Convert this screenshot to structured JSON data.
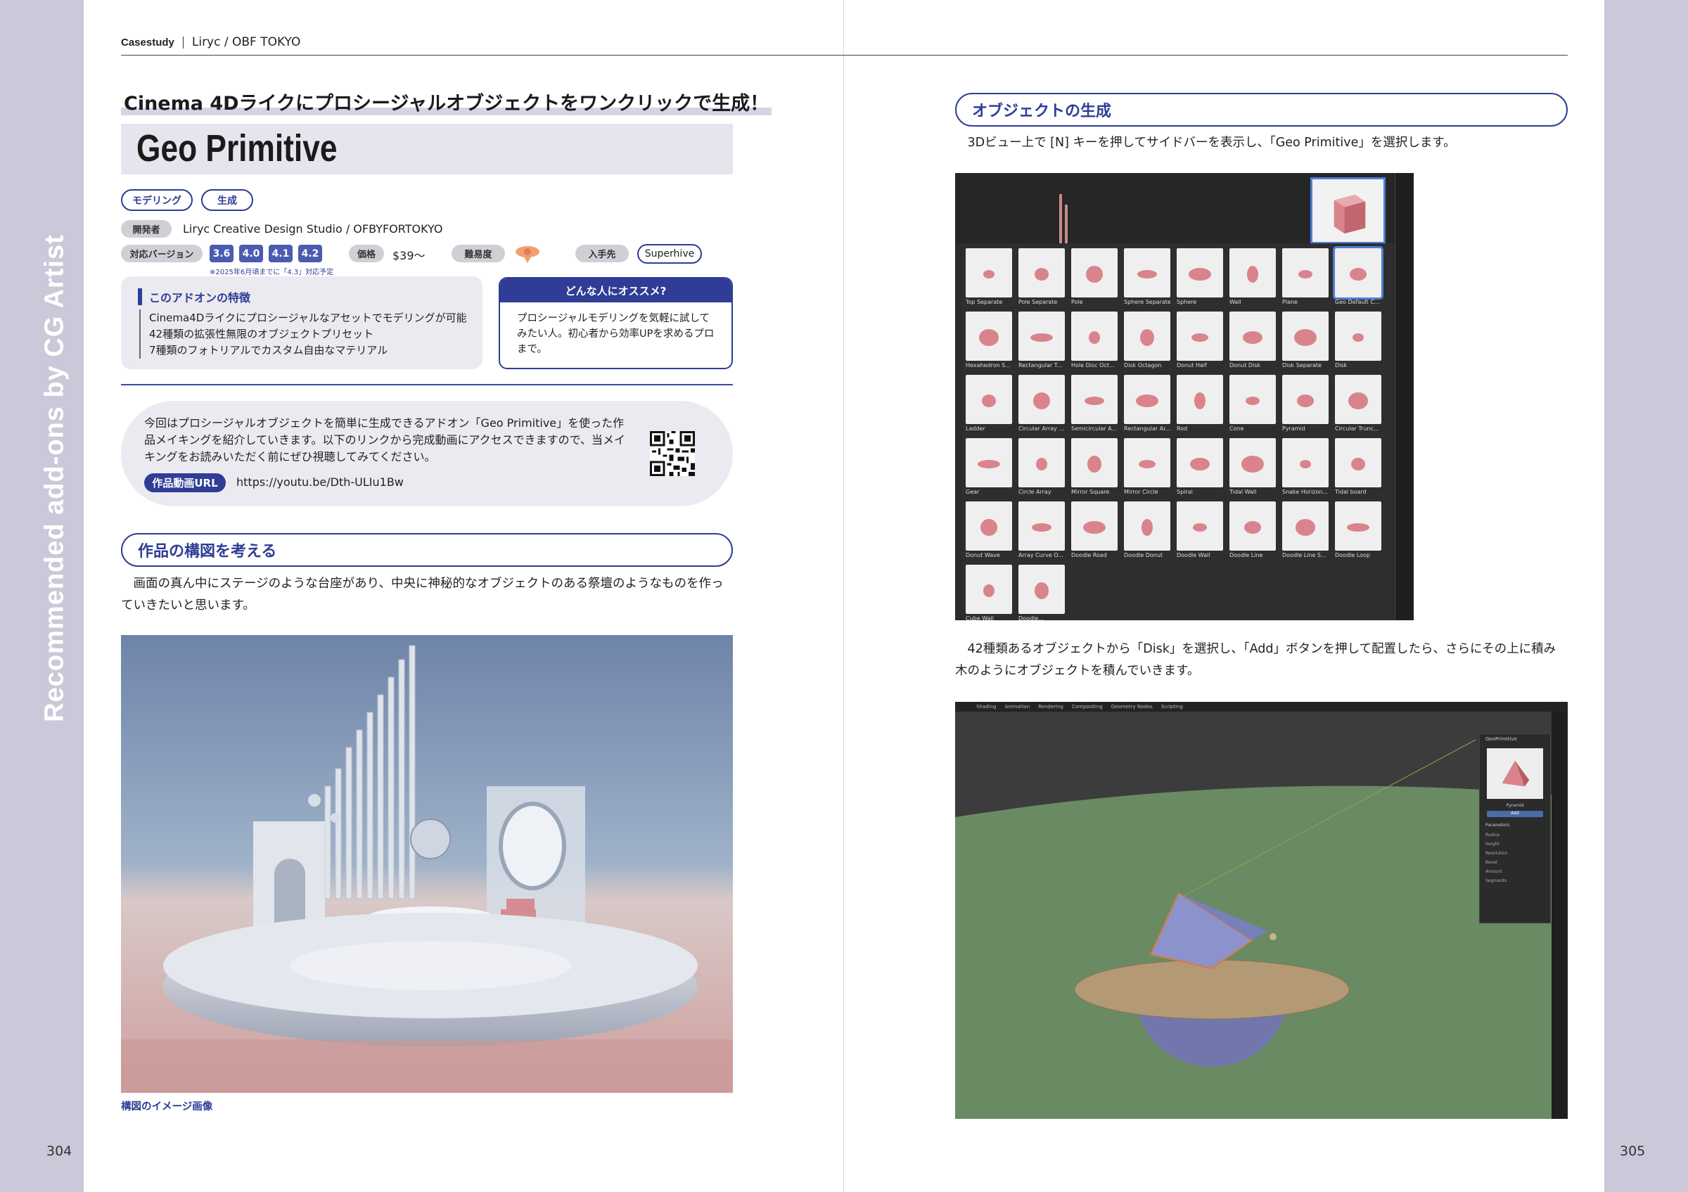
{
  "header": {
    "section": "Casestudy",
    "author": "Liryc / OBF TOKYO"
  },
  "sidebar_title": "Recommended add-ons by CG Artist",
  "pages": {
    "left": "304",
    "right": "305"
  },
  "left": {
    "subtitle": "Cinema 4Dライクにプロシージャルオブジェクトをワンクリックで生成！",
    "title": "Geo Primitive",
    "tags": [
      "モデリング",
      "生成"
    ],
    "developer_label": "開発者",
    "developer": "Liryc Creative Design Studio / OFBYFORTOKYO",
    "version_label": "対応バージョン",
    "versions": [
      "3.6",
      "4.0",
      "4.1",
      "4.2"
    ],
    "version_note": "※2025年6月頃までに「4.3」対応予定",
    "price_label": "価格",
    "price": "$39〜",
    "difficulty_label": "難易度",
    "source_label": "入手先",
    "source": "Superhive",
    "features": {
      "title": "このアドオンの特徴",
      "items": [
        "Cinema4Dライクにプロシージャルなアセットでモデリングが可能",
        "42種類の拡張性無限のオブジェクトプリセット",
        "7種類のフォトリアルでカスタム自由なマテリアル"
      ]
    },
    "recommend": {
      "title": "どんな人にオススメ?",
      "body": "プロシージャルモデリングを気軽に試してみたい人。初心者から効率UPを求めるプロまで。"
    },
    "intro": "今回はプロシージャルオブジェクトを簡単に生成できるアドオン「Geo Primitive」を使った作品メイキングを紹介していきます。以下のリンクから完成動画にアクセスできますので、当メイキングをお読みいただく前にぜひ視聴してみてください。",
    "video_label": "作品動画URL",
    "video_url": "https://youtu.be/Dth-ULIu1Bw",
    "section1_title": "作品の構図を考える",
    "section1_body": "画面の真ん中にステージのような台座があり、中央に神秘的なオブジェクトのある祭壇のようなものを作っていきたいと思います。",
    "photo_caption": "構図のイメージ画像"
  },
  "right": {
    "section_title": "オブジェクトの生成",
    "body1": "3Dビュー上で [N] キーを押してサイドバーを表示し、「Geo Primitive」を選択します。",
    "body2": "42種類あるオブジェクトから「Disk」を選択し、「Add」ボタンを押して配置したら、さらにその上に積み木のようにオブジェクトを積んでいきます。",
    "thumbs": [
      "Top Separate",
      "Pole Separate",
      "Pole",
      "Sphere Separate",
      "Sphere",
      "Wall",
      "Plane",
      "Geo Default C...",
      "Hexahedron S...",
      "Rectangular T...",
      "Hole Disc Oct...",
      "Disk Octagon",
      "Donut Half",
      "Donut Disk",
      "Disk Separate",
      "Disk",
      "Ladder",
      "Circular Array ...",
      "Semicircular A...",
      "Rectangular Ar...",
      "Rod",
      "Cone",
      "Pyramid",
      "Circular Trunc...",
      "Gear",
      "Circle Array",
      "Mirror Square",
      "Mirror Circle",
      "Spiral",
      "Tidal Wall",
      "Snake Horizon...",
      "Tidal board",
      "Donut Wave",
      "Array Curve O...",
      "Doodle Road",
      "Doodle Donut",
      "Doodle Wall",
      "Doodle Line",
      "Doodle Line S...",
      "Doodle Loop",
      "Cube Wall",
      "Doodle..."
    ],
    "viewport_tabs": [
      "Shading",
      "Animation",
      "Rendering",
      "Compositing",
      "Geometry Nodes",
      "Scripting"
    ],
    "panel": {
      "header": "GeoPrimitive",
      "preview": "Pyramid",
      "add": "Add",
      "params": "Parameters",
      "radius": "Radius",
      "height": "Height",
      "resolution": "Resolution",
      "bevel": "Bevel",
      "amount": "Amount",
      "segments": "Segments"
    }
  },
  "colors": {
    "accent": "#2f3d96",
    "sidebar": "#cbc8d9",
    "pink": "#d9848c"
  }
}
